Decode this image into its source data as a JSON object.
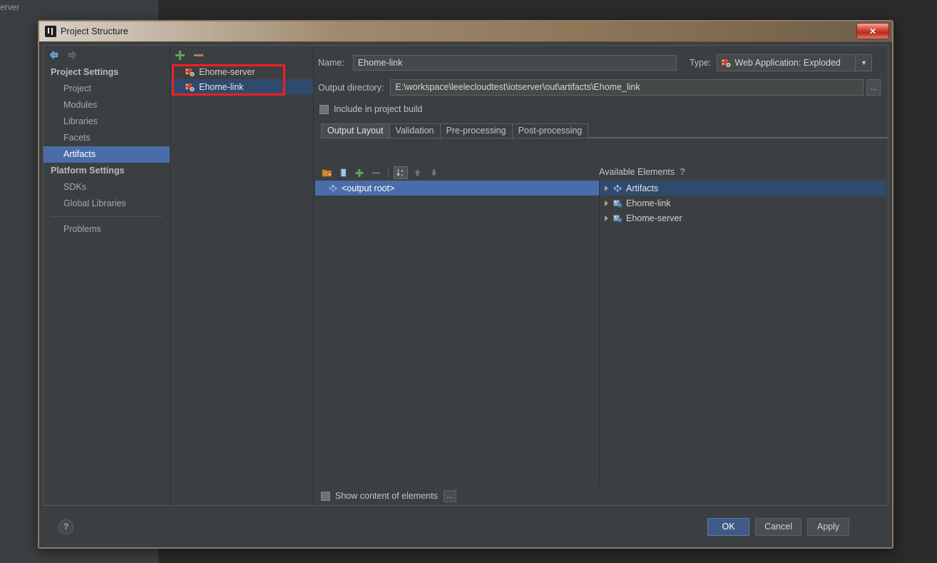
{
  "background": {
    "behind_window_label": "erver"
  },
  "dialog": {
    "title": "Project Structure",
    "title_icon": "intellij-idea-icon",
    "close_label": "✕"
  },
  "nav": {
    "back_icon": "arrow-left-icon",
    "forward_icon": "arrow-right-icon"
  },
  "sidebar": {
    "groups": [
      {
        "label": "Project Settings",
        "items": [
          {
            "label": "Project",
            "selected": false
          },
          {
            "label": "Modules",
            "selected": false
          },
          {
            "label": "Libraries",
            "selected": false
          },
          {
            "label": "Facets",
            "selected": false
          },
          {
            "label": "Artifacts",
            "selected": true
          }
        ]
      },
      {
        "label": "Platform Settings",
        "items": [
          {
            "label": "SDKs",
            "selected": false
          },
          {
            "label": "Global Libraries",
            "selected": false
          }
        ]
      }
    ],
    "problems_label": "Problems"
  },
  "artifact_panel": {
    "add_icon": "plus-icon",
    "remove_icon": "minus-icon",
    "items": [
      {
        "label": "Ehome-server",
        "icon": "artifact-icon",
        "selected": false
      },
      {
        "label": "Ehome-link",
        "icon": "artifact-icon",
        "selected": true
      }
    ],
    "highlight_color": "#f02020"
  },
  "form": {
    "name_label": "Name:",
    "name_value": "Ehome-link",
    "name_placeholder": "",
    "type_label": "Type:",
    "type_value": "Web Application: Exploded",
    "type_icon": "artifact-icon",
    "type_arrow_icon": "chevron-down-icon",
    "output_dir_label": "Output directory:",
    "output_dir_value": "E:\\workspace\\leelecloudtest\\iotserver\\out\\artifacts\\Ehome_link",
    "browse_label": "...",
    "include_build_label": "Include in project build",
    "include_build_checked": false
  },
  "tabs": [
    {
      "label": "Output Layout",
      "active": true
    },
    {
      "label": "Validation",
      "active": false
    },
    {
      "label": "Pre-processing",
      "active": false
    },
    {
      "label": "Post-processing",
      "active": false
    }
  ],
  "layout_toolbar": [
    {
      "name": "add-directory-icon",
      "pressed": false
    },
    {
      "name": "add-archive-icon",
      "pressed": false
    },
    {
      "name": "add-copy-icon",
      "pressed": false
    },
    {
      "name": "remove-icon",
      "pressed": false
    },
    {
      "name": "sort-icon",
      "pressed": true
    },
    {
      "name": "move-up-icon",
      "pressed": false
    },
    {
      "name": "move-down-icon",
      "pressed": false
    }
  ],
  "output_tree": {
    "root_label": "<output root>",
    "root_icon": "output-root-icon"
  },
  "available_elements": {
    "title": "Available Elements",
    "help_icon": "?",
    "nodes": [
      {
        "label": "Artifacts",
        "icon": "artifacts-group-icon",
        "selected": true,
        "expandable": true
      },
      {
        "label": "Ehome-link",
        "icon": "module-icon",
        "selected": false,
        "expandable": true
      },
      {
        "label": "Ehome-server",
        "icon": "module-icon",
        "selected": false,
        "expandable": true
      }
    ]
  },
  "bottom": {
    "show_content_label": "Show content of elements",
    "show_content_checked": false,
    "more_label": "..."
  },
  "footer": {
    "help_label": "?",
    "ok_label": "OK",
    "cancel_label": "Cancel",
    "apply_label": "Apply"
  }
}
